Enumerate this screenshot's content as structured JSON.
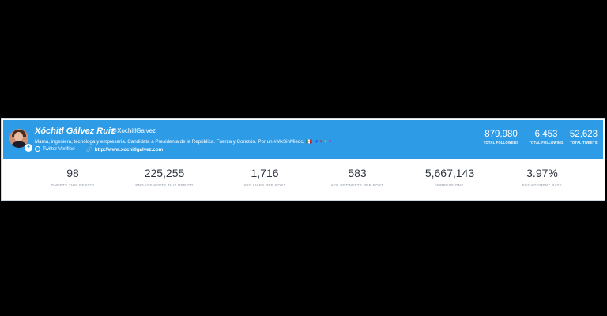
{
  "profile": {
    "name": "Xóchitl Gálvez Ruiz",
    "handle": "@XochitlGalvez",
    "bio": "Mamá, ingeniera, tecnóloga y empresaria. Candidata a Presidenta de la República. Fuerza y Corazón. Por un #MxSinMiedo. 🇲🇽",
    "hearts": [
      "♥",
      "♥",
      "♥",
      "♥"
    ],
    "verified_label": "Twitter Verified",
    "website": "http://www.xochitlgalvez.com"
  },
  "header_stats": [
    {
      "value": "879,980",
      "label": "TOTAL FOLLOWERS"
    },
    {
      "value": "6,453",
      "label": "TOTAL FOLLOWING"
    },
    {
      "value": "52,623",
      "label": "TOTAL TWEETS"
    }
  ],
  "stats": [
    {
      "value": "98",
      "label": "TWEETS THIS PERIOD"
    },
    {
      "value": "225,255",
      "label": "ENGAGEMENTS THIS PERIOD"
    },
    {
      "value": "1,716",
      "label": "AVG LIKES PER POST"
    },
    {
      "value": "583",
      "label": "AVG RETWEETS PER POST"
    },
    {
      "value": "5,667,143",
      "label": "IMPRESSIONS"
    },
    {
      "value": "3.97%",
      "label": "ENGAGEMENT RATE"
    }
  ],
  "colors": {
    "header": "#2e9be6",
    "value_text": "#2c3440",
    "label_text": "#8c96a3"
  }
}
